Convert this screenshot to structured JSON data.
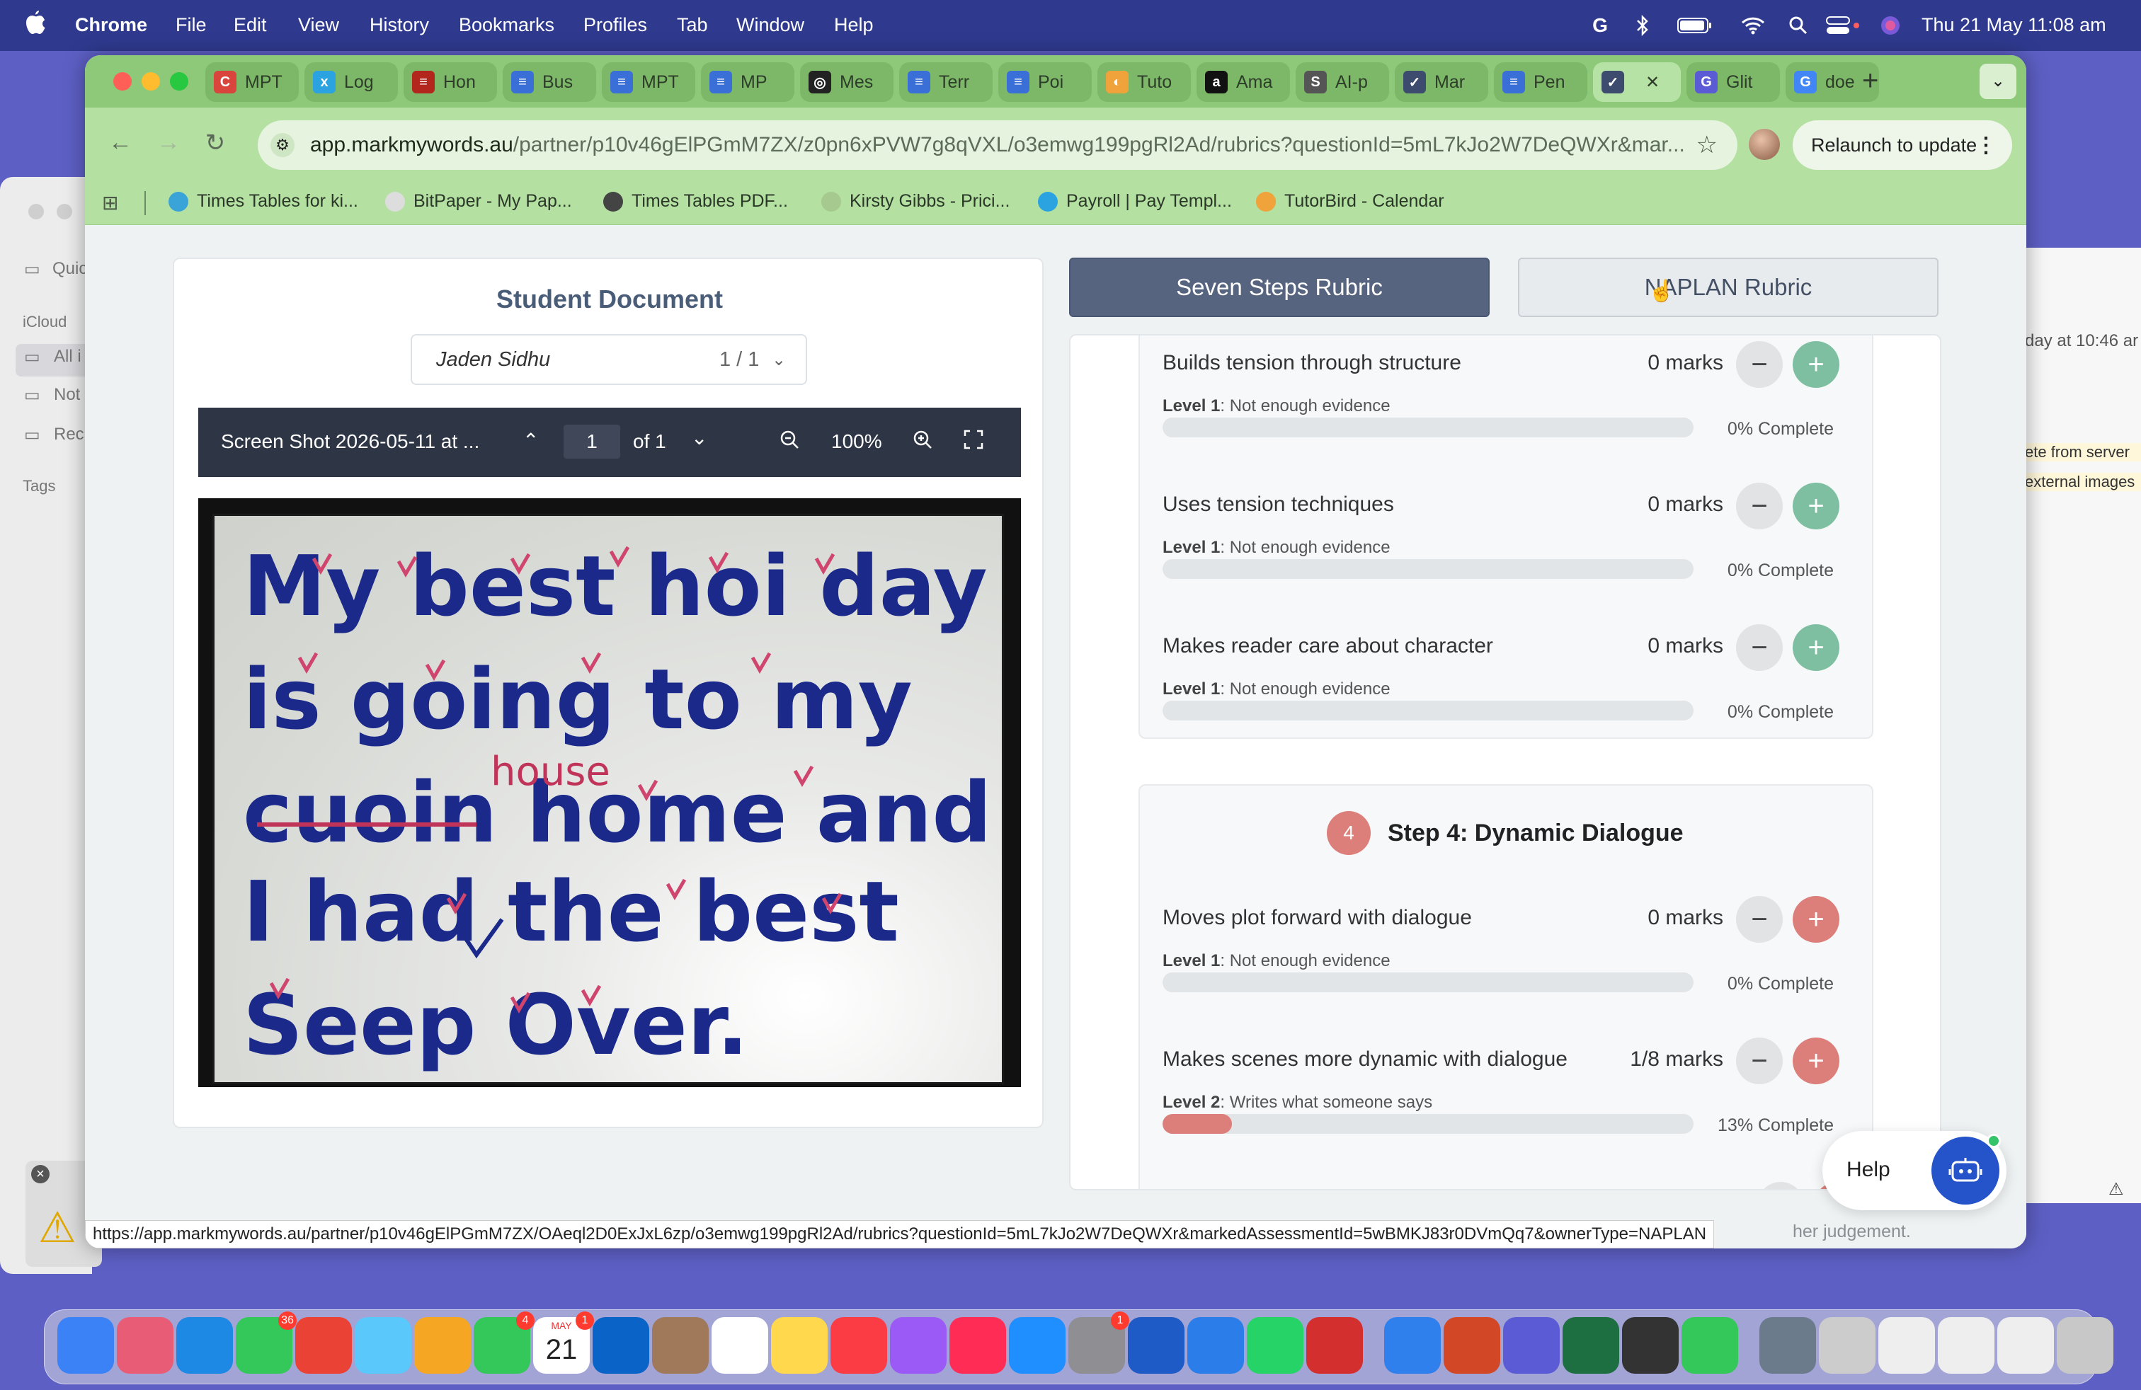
{
  "menubar": {
    "app_name": "Chrome",
    "items": [
      "File",
      "Edit",
      "View",
      "History",
      "Bookmarks",
      "Profiles",
      "Tab",
      "Window",
      "Help"
    ],
    "datetime": "Thu 21 May  11:08 am"
  },
  "background_window": {
    "sidebar_items": [
      "Quic",
      "iCloud",
      "All i",
      "Not",
      "Rec",
      "Tags"
    ],
    "right_texts": [
      "day at 10:46 ar",
      "ete from server",
      "external images"
    ],
    "footer_text": "her judgement."
  },
  "tabs": [
    {
      "label": "MPT",
      "color": "#d9453c",
      "icon": "C"
    },
    {
      "label": "Log",
      "color": "#2aa3e0",
      "icon": "x"
    },
    {
      "label": "Hon",
      "color": "#b3261e",
      "icon": "≡"
    },
    {
      "label": "Bus",
      "color": "#3b6fd8",
      "icon": "≡"
    },
    {
      "label": "MPT",
      "color": "#3b6fd8",
      "icon": "≡"
    },
    {
      "label": "MP",
      "color": "#3b6fd8",
      "icon": "≡"
    },
    {
      "label": "Mes",
      "color": "#222222",
      "icon": "◎"
    },
    {
      "label": "Terr",
      "color": "#3b6fd8",
      "icon": "≡"
    },
    {
      "label": "Poi",
      "color": "#3b6fd8",
      "icon": "≡"
    },
    {
      "label": "Tuto",
      "color": "#f0a23b",
      "icon": "◐"
    },
    {
      "label": "Ama",
      "color": "#111111",
      "icon": "a"
    },
    {
      "label": "AI-p",
      "color": "#555555",
      "icon": "S"
    },
    {
      "label": "Mar",
      "color": "#3d4b6e",
      "icon": "✓"
    },
    {
      "label": "Pen",
      "color": "#3b6fd8",
      "icon": "≡"
    },
    {
      "label": "",
      "color": "#3d4b6e",
      "icon": "✓",
      "active": true
    },
    {
      "label": "Glit",
      "color": "#5b5bd6",
      "icon": "G"
    },
    {
      "label": "doe",
      "color": "#4285f4",
      "icon": "G"
    }
  ],
  "omnibox": {
    "host": "app.markmywords.au",
    "path": "/partner/p10v46gElPGmM7ZX/z0pn6xPVW7g8qVXL/o3emwg199pgRl2Ad/rubrics?questionId=5mL7kJo2W7DeQWXr&mar..."
  },
  "relaunch_label": "Relaunch to update",
  "bookmarks": [
    {
      "label": "Times Tables for ki...",
      "color": "#3aa3d8"
    },
    {
      "label": "BitPaper - My Pap...",
      "color": "#dddddd"
    },
    {
      "label": "Times Tables PDF...",
      "color": "#444444"
    },
    {
      "label": "Kirsty Gibbs - Prici...",
      "color": "#a6c98f"
    },
    {
      "label": "Payroll | Pay Templ...",
      "color": "#2aa3e0"
    },
    {
      "label": "TutorBird - Calendar",
      "color": "#f0a23b"
    }
  ],
  "document": {
    "title": "Student Document",
    "student": "Jaden Sidhu",
    "student_pages": "1 / 1",
    "file_name": "Screen Shot 2026-05-11 at ...",
    "page_current": "1",
    "page_total": "of 1",
    "zoom": "100%",
    "handwriting": [
      "My best hoi day",
      "is going to my",
      "cuoin home and",
      "I had the best",
      "Seep Over."
    ],
    "correction": "house"
  },
  "rubric_tabs": {
    "seven_steps": "Seven Steps Rubric",
    "naplan": "NAPLAN Rubric"
  },
  "rubric": {
    "accent_green": "#7dbfa0",
    "accent_red": "#dc7f7a",
    "step3_criteria": [
      {
        "name": "Builds tension through structure",
        "marks": "0 marks",
        "level": "Level 1",
        "desc": "Not enough evidence",
        "progress": 0,
        "pct": "0% Complete"
      },
      {
        "name": "Uses tension techniques",
        "marks": "0 marks",
        "level": "Level 1",
        "desc": "Not enough evidence",
        "progress": 0,
        "pct": "0% Complete"
      },
      {
        "name": "Makes reader care about character",
        "marks": "0 marks",
        "level": "Level 1",
        "desc": "Not enough evidence",
        "progress": 0,
        "pct": "0% Complete"
      }
    ],
    "step4": {
      "number": "4",
      "title": "Step 4: Dynamic Dialogue",
      "criteria": [
        {
          "name": "Moves plot forward with dialogue",
          "marks": "0 marks",
          "level": "Level 1",
          "desc": "Not enough evidence",
          "progress": 0,
          "pct": "0% Complete"
        },
        {
          "name": "Makes scenes more dynamic with dialogue",
          "marks": "1/8 marks",
          "level": "Level 2",
          "desc": "Writes what someone says",
          "progress": 0.13,
          "pct": "13% Complete"
        }
      ]
    }
  },
  "help_label": "Help",
  "status_url": "https://app.markmywords.au/partner/p10v46gElPGmM7ZX/OAeql2D0ExJxL6zp/o3emwg199pgRl2Ad/rubrics?questionId=5mL7kJo2W7DeQWXr&markedAssessmentId=5wBMKJ83r0DVmQq7&ownerType=NAPLAN",
  "dock": {
    "badges": {
      "messages": "36",
      "facetime": "4",
      "calendar": "1",
      "settings": "1"
    },
    "calendar_month": "MAY",
    "calendar_day": "21"
  }
}
